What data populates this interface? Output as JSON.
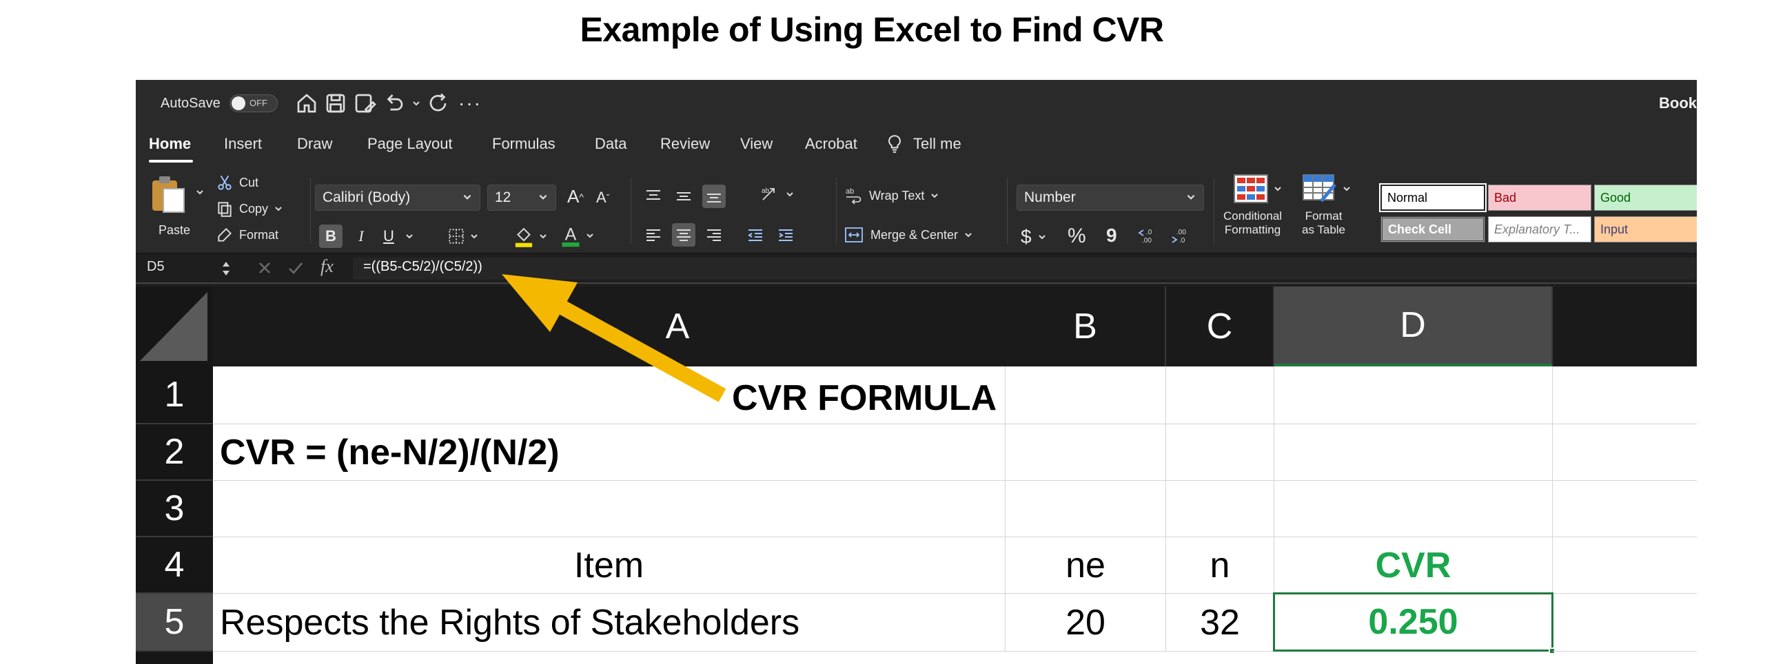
{
  "page_title": "Example of Using Excel to Find CVR",
  "titlebar": {
    "autosave_label": "AutoSave",
    "autosave_state": "OFF",
    "quick_access": [
      "home-icon",
      "save-icon",
      "save-as-icon",
      "undo-icon",
      "redo-icon",
      "more-icon"
    ],
    "book_title": "Book"
  },
  "tabs": [
    "Home",
    "Insert",
    "Draw",
    "Page Layout",
    "Formulas",
    "Data",
    "Review",
    "View",
    "Acrobat"
  ],
  "tell_me": "Tell me",
  "ribbon": {
    "paste": "Paste",
    "cut": "Cut",
    "copy": "Copy",
    "format": "Format",
    "font_name": "Calibri (Body)",
    "font_size": "12",
    "bold": "B",
    "italic": "I",
    "underline": "U",
    "wrap_text": "Wrap Text",
    "merge_center": "Merge & Center",
    "number_format": "Number",
    "currency": "$",
    "percent": "%",
    "comma": "9",
    "conditional_formatting_1": "Conditional",
    "conditional_formatting_2": "Formatting",
    "format_table_1": "Format",
    "format_table_2": "as Table",
    "styles": {
      "normal": "Normal",
      "bad": "Bad",
      "good": "Good",
      "check_cell": "Check Cell",
      "explanatory": "Explanatory T...",
      "input": "Input"
    }
  },
  "formula_bar": {
    "name_box": "D5",
    "formula": "=((B5-C5/2)/(C5/2))"
  },
  "columns": [
    "A",
    "B",
    "C",
    "D"
  ],
  "rows": [
    "1",
    "2",
    "3",
    "4",
    "5"
  ],
  "cells": {
    "A2": "CVR = (ne-N/2)/(N/2)",
    "A4": "Item",
    "B4": "ne",
    "C4": "n",
    "D4": "CVR",
    "A5": "Respects the Rights of Stakeholders",
    "B5": "20",
    "C5": "32",
    "D5": "0.250"
  },
  "annotation": "CVR FORMULA",
  "colors": {
    "accent_green": "#1aa64b",
    "arrow": "#f5b800"
  }
}
